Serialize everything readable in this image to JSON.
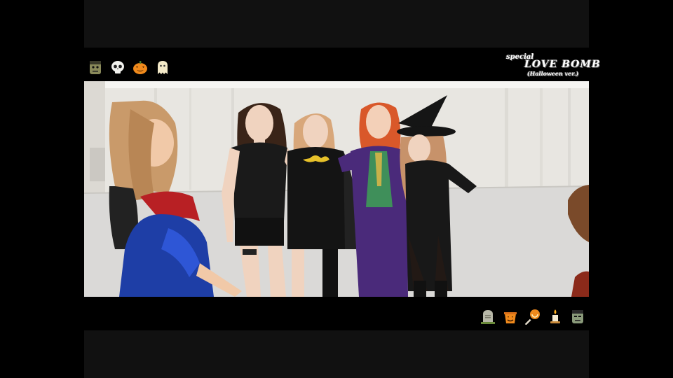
{
  "video": {
    "watermark": {
      "line1": "special",
      "line2": "LOVE BOMB",
      "line3": "(Halloween ver.)"
    },
    "top_decorations": [
      "frankenstein-icon",
      "skull-icon",
      "pumpkin-icon",
      "ghost-icon"
    ],
    "bottom_decorations": [
      "tombstone-icon",
      "candy-bucket-icon",
      "lollipop-icon",
      "candle-icon",
      "frankenstein-icon"
    ],
    "colors": {
      "letterbox": "#000000",
      "wall": "#ecebe7",
      "floor": "#d9d8d6"
    }
  }
}
